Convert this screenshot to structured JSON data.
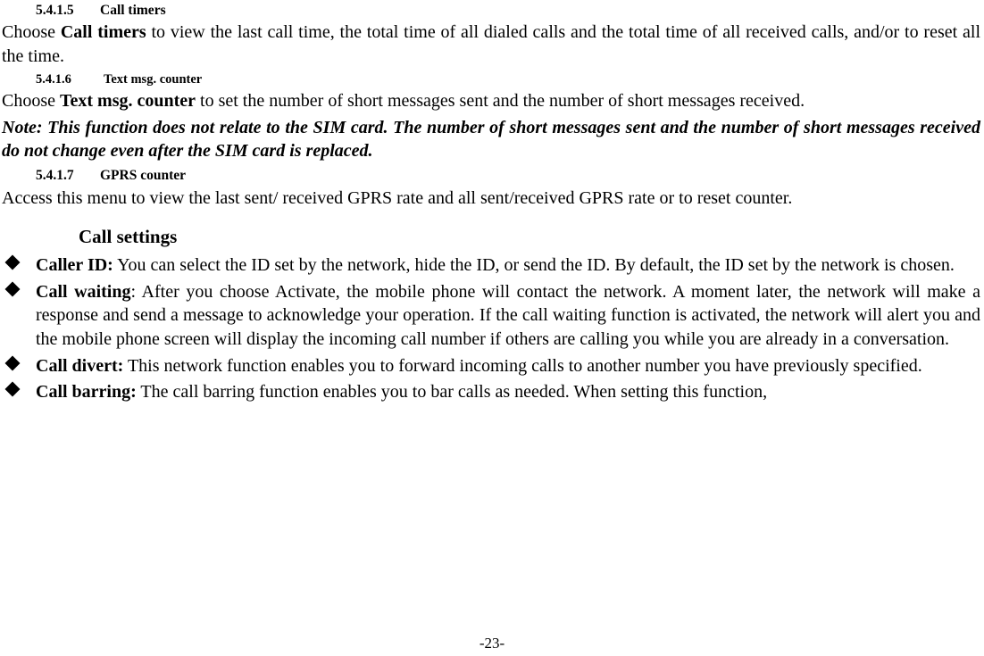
{
  "document": {
    "sections": [
      {
        "number": "5.4.1.5",
        "title": "Call timers",
        "body_lead": "Choose ",
        "body_bold": "Call timers",
        "body_rest": " to view the last call time, the total time of all dialed calls and the total time of all received calls, and/or to reset all the time."
      },
      {
        "number": "5.4.1.6",
        "title": "Text msg. counter",
        "body_lead": "Choose ",
        "body_bold": "Text msg. counter",
        "body_rest": " to set the number of short messages sent and the number of short messages received.",
        "note": "Note: This function does not relate to the SIM card. The number of short messages sent and the number of short messages received do not change even after the SIM card is replaced."
      },
      {
        "number": "5.4.1.7",
        "title": "GPRS counter",
        "body_rest": "Access this menu to view the last sent/ received GPRS rate and all sent/received GPRS rate or to reset counter."
      }
    ],
    "call_settings": {
      "title": "Call settings",
      "items": [
        {
          "term": "Caller ID:",
          "term_sep": " ",
          "text": "You can select the ID set by the network, hide the ID, or send the ID. By default, the ID set by the network is chosen."
        },
        {
          "term": "Call waiting",
          "term_sep": ": ",
          "text": "After you choose Activate, the mobile phone will contact the network. A moment later, the network will make a response and send a message to acknowledge your operation. If the call waiting function is activated, the network will alert you and the mobile phone screen will display the incoming call number if others are calling you while you are already in a conversation."
        },
        {
          "term": "Call divert:",
          "term_sep": " ",
          "text": "This network function enables you to forward incoming calls to another number you have previously specified."
        },
        {
          "term": "Call barring:",
          "term_sep": " ",
          "text": "The call barring function enables you to bar calls as needed. When setting this function,"
        }
      ]
    },
    "footer": {
      "page_number": "-23-"
    }
  }
}
